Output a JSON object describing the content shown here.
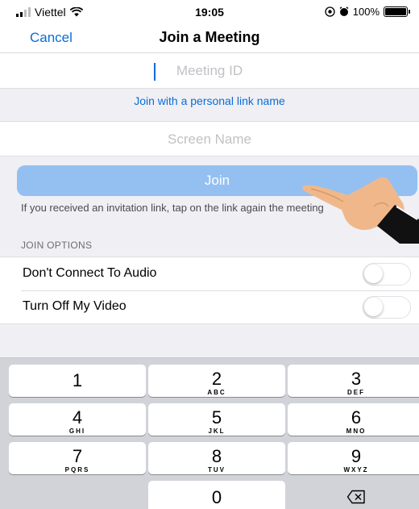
{
  "status_bar": {
    "carrier": "Viettel",
    "time": "19:05",
    "battery": "100%",
    "battery_level": 1.0
  },
  "nav": {
    "cancel_label": "Cancel",
    "title": "Join a Meeting"
  },
  "meeting_id": {
    "placeholder": "Meeting ID",
    "value": ""
  },
  "personal_link": {
    "label": "Join with a personal link name"
  },
  "screen_name": {
    "placeholder": "Screen Name",
    "value": ""
  },
  "join_button": {
    "label": "Join"
  },
  "invite_hint": {
    "text": "If you received an invitation link, tap on the link again the meeting"
  },
  "join_options": {
    "header": "JOIN OPTIONS",
    "items": [
      {
        "label": "Don't Connect To Audio",
        "on": false
      },
      {
        "label": "Turn Off My Video",
        "on": false
      }
    ]
  },
  "keypad": {
    "keys": [
      {
        "digit": "1",
        "letters": ""
      },
      {
        "digit": "2",
        "letters": "ABC"
      },
      {
        "digit": "3",
        "letters": "DEF"
      },
      {
        "digit": "4",
        "letters": "GHI"
      },
      {
        "digit": "5",
        "letters": "JKL"
      },
      {
        "digit": "6",
        "letters": "MNO"
      },
      {
        "digit": "7",
        "letters": "PQRS"
      },
      {
        "digit": "8",
        "letters": "TUV"
      },
      {
        "digit": "9",
        "letters": "WXYZ"
      },
      {
        "digit": "0",
        "letters": ""
      }
    ]
  },
  "colors": {
    "accent": "#0b6cd7",
    "join_button_bg": "#93c0f1",
    "keypad_bg": "#d1d3d9",
    "hand_skin": "#f0b88a"
  }
}
